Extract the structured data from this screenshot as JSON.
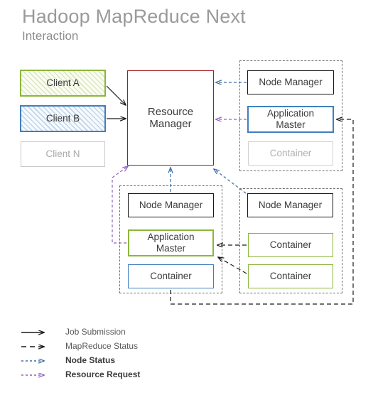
{
  "header": {
    "title": "Hadoop MapReduce Next",
    "subtitle": "Interaction"
  },
  "colors": {
    "green": "#8cb63c",
    "blue": "#3f7fbf",
    "red": "#a31b1b",
    "black": "#1a1a1a",
    "gray": "#b0b0b0",
    "purple": "#8f5fc4",
    "node_status_blue": "#3a6ea5",
    "title_gray": "#9a9a9a"
  },
  "clients": [
    {
      "label": "Client A",
      "style": "green-hatched"
    },
    {
      "label": "Client B",
      "style": "blue-hatched"
    },
    {
      "label": "Client N",
      "style": "gray-outline"
    }
  ],
  "resource_manager": {
    "line1": "Resource",
    "line2": "Manager"
  },
  "clusters": [
    {
      "id": "cluster-top-right",
      "nodes": [
        {
          "label": "Node Manager",
          "style": "black-outline"
        },
        {
          "label_line1": "Application",
          "label_line2": "Master",
          "style": "blue-outline"
        },
        {
          "label": "Container",
          "style": "gray-outline"
        }
      ]
    },
    {
      "id": "cluster-bottom-left",
      "nodes": [
        {
          "label": "Node Manager",
          "style": "black-outline"
        },
        {
          "label_line1": "Application",
          "label_line2": "Master",
          "style": "green-outline"
        },
        {
          "label": "Container",
          "style": "blue-outline"
        }
      ]
    },
    {
      "id": "cluster-bottom-right",
      "nodes": [
        {
          "label": "Node Manager",
          "style": "black-outline"
        },
        {
          "label": "Container",
          "style": "green-outline"
        },
        {
          "label": "Container",
          "style": "green-outline"
        }
      ]
    }
  ],
  "legend": [
    {
      "label": "Job Submission",
      "line": "solid",
      "color": "#1a1a1a",
      "bold": false
    },
    {
      "label": "MapReduce Status",
      "line": "dashed",
      "color": "#1a1a1a",
      "bold": false
    },
    {
      "label": "Node Status",
      "line": "dotted",
      "color": "#3a6ea5",
      "bold": true
    },
    {
      "label": "Resource Request",
      "line": "dotted",
      "color": "#8f5fc4",
      "bold": true
    }
  ]
}
